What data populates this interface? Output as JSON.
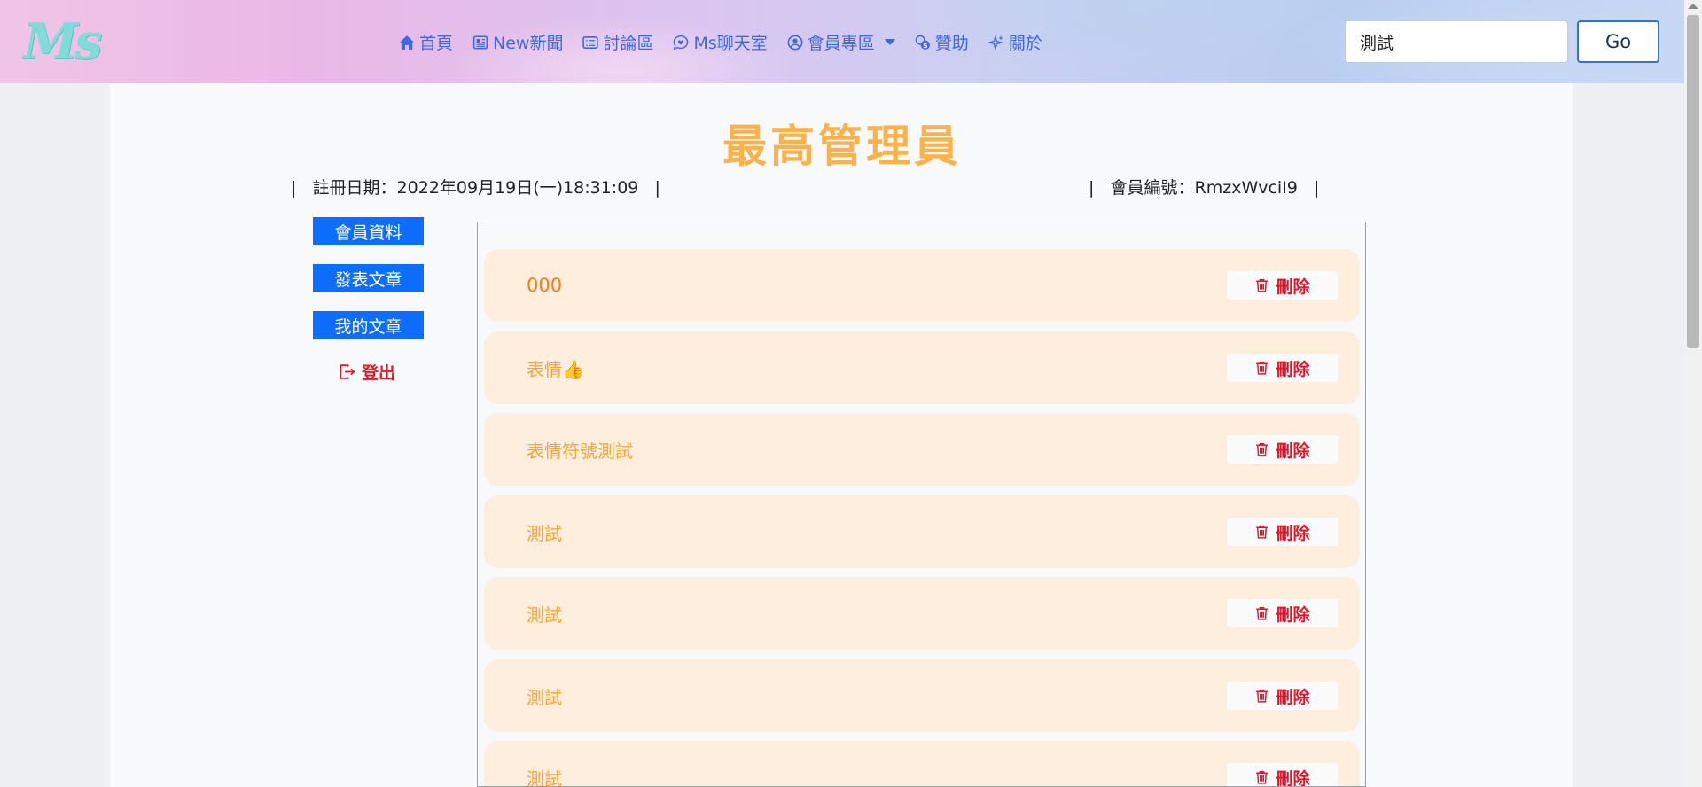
{
  "header": {
    "logo": "Ms",
    "nav": [
      {
        "label": "首頁",
        "icon": "home-icon"
      },
      {
        "label": "New新聞",
        "icon": "newspaper-icon"
      },
      {
        "label": "討論區",
        "icon": "card-list-icon"
      },
      {
        "label": "Ms聊天室",
        "icon": "chat-heart-icon"
      },
      {
        "label": "會員專區",
        "icon": "person-circle-icon",
        "dropdown": true
      },
      {
        "label": "贊助",
        "icon": "coins-icon"
      },
      {
        "label": "關於",
        "icon": "sparkles-icon"
      }
    ],
    "search_value": "測試",
    "go_label": "Go"
  },
  "profile": {
    "title": "最高管理員",
    "register_info": "|   註冊日期：2022年09月19日(一)18:31:09   |",
    "member_info": "|   會員編號：RmzxWvciI9   |"
  },
  "sidebar": {
    "buttons": [
      "會員資料",
      "發表文章",
      "我的文章"
    ],
    "logout": "登出"
  },
  "articles": {
    "delete_label": "刪除",
    "items": [
      "000",
      "表情👍",
      "表情符號測試",
      "測試",
      "測試",
      "測試",
      "測試"
    ]
  },
  "colors": {
    "accent": "#0d6efd",
    "title": "#fbb24b",
    "danger": "#e0162b",
    "nav": "#3f67e0",
    "card": "#fdeedd"
  }
}
